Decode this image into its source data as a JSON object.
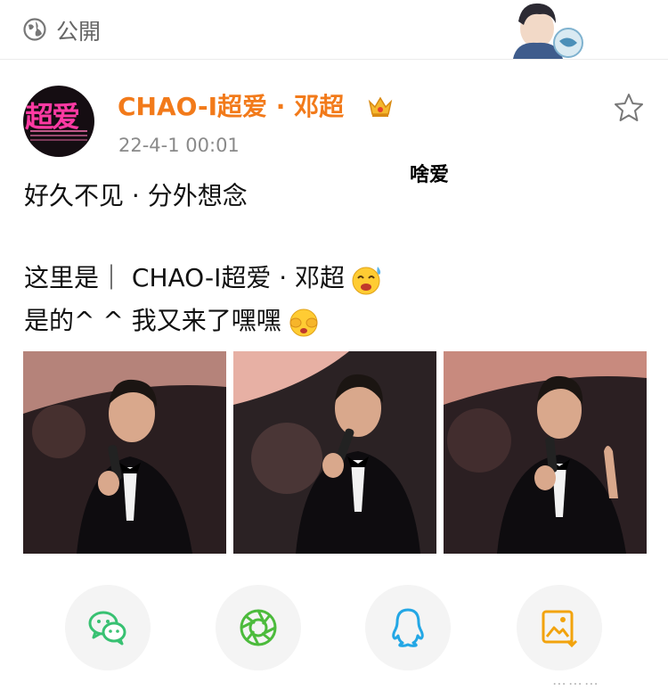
{
  "header": {
    "visibility_label": "公開",
    "visibility_icon": "globe-icon"
  },
  "post": {
    "avatar_text": "超爱",
    "username": "CHAO-I超爱 · 邓超",
    "badge_icon": "crown-icon",
    "timestamp": "22-4-1 00:01",
    "favorite_icon": "star-outline-icon",
    "overlay_caption": "啥爱",
    "text_lines": [
      "好久不见 · 分外想念",
      "这里是｜ CHAO-I超爱 · 邓超",
      "是的^ ^ 我又来了嘿嘿"
    ],
    "photos": [
      "photo-1",
      "photo-2",
      "photo-3"
    ]
  },
  "share": {
    "buttons": [
      {
        "icon": "wechat-icon",
        "color": "#38c172"
      },
      {
        "icon": "moments-icon",
        "color": "#4cbb3c"
      },
      {
        "icon": "qq-icon",
        "color": "#23a7e5"
      },
      {
        "icon": "save-image-icon",
        "color": "#f2a30d"
      }
    ]
  },
  "colors": {
    "username": "#f27a1a",
    "accent_pink": "#ff3aa3"
  }
}
